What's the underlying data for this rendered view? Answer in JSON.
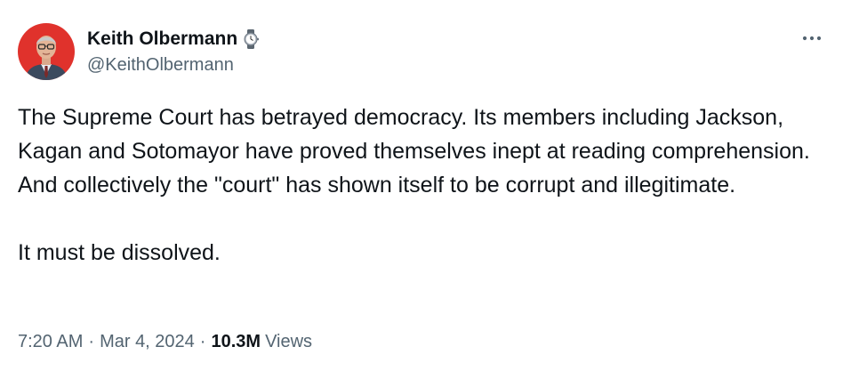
{
  "author": {
    "display_name": "Keith Olbermann",
    "handle": "@KeithOlbermann",
    "badge_icon": "watch-icon",
    "avatar_bg": "#e0322c"
  },
  "tweet": {
    "paragraphs": [
      "The Supreme Court has betrayed democracy. Its members including Jackson, Kagan and Sotomayor have proved themselves inept at reading comprehension. And collectively the \"court\" has shown itself to be corrupt and illegitimate.",
      "It must be dissolved."
    ]
  },
  "meta": {
    "time": "7:20 AM",
    "separator": "·",
    "date": "Mar 4, 2024",
    "views_count": "10.3M",
    "views_label": "Views"
  },
  "more_icon": "more-horizontal-icon",
  "colors": {
    "text_primary": "#0f1419",
    "text_secondary": "#536471"
  }
}
